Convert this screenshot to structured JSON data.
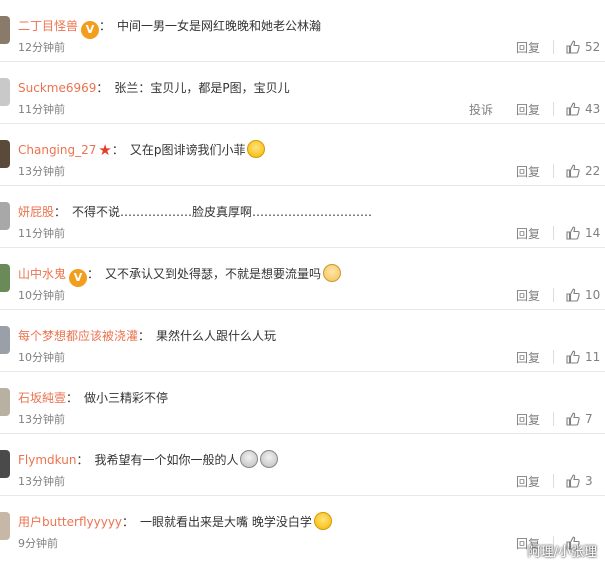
{
  "colors": {
    "username": "#eb7350",
    "text": "#333333",
    "meta": "#808080",
    "divider": "#e8e8e8"
  },
  "labels": {
    "reply": "回复",
    "report": "投诉"
  },
  "comments": [
    {
      "user": "二丁目怪兽",
      "badge": "v-badge",
      "text": "中间一男一女是网红晚晚和她老公林瀚",
      "time": "12分钟前",
      "likes": "52",
      "report": false,
      "emoji": ""
    },
    {
      "user": "Suckme6969",
      "badge": "",
      "text": "张兰：宝贝儿，都是P图，宝贝儿",
      "time": "11分钟前",
      "likes": "43",
      "report": true,
      "emoji": ""
    },
    {
      "user": "Changing_27",
      "badge": "star-badge",
      "text": "又在p图诽谤我们小菲",
      "time": "13分钟前",
      "likes": "22",
      "report": false,
      "emoji": "smile"
    },
    {
      "user": "妍屁股",
      "badge": "",
      "text": "不得不说………………脸皮真厚啊…………………………",
      "time": "11分钟前",
      "likes": "14",
      "report": false,
      "emoji": ""
    },
    {
      "user": "山中水鬼",
      "badge": "v-badge",
      "text": "又不承认又到处得瑟，不就是想要流量吗",
      "time": "10分钟前",
      "likes": "10",
      "report": false,
      "emoji": "cat"
    },
    {
      "user": "每个梦想都应该被浇灌",
      "badge": "",
      "text": "果然什么人跟什么人玩",
      "time": "10分钟前",
      "likes": "11",
      "report": false,
      "emoji": ""
    },
    {
      "user": "石坂純壹",
      "badge": "",
      "text": "做小三精彩不停",
      "time": "13分钟前",
      "likes": "7",
      "report": false,
      "emoji": ""
    },
    {
      "user": "Flymdkun",
      "badge": "",
      "text": "我希望有一个如你一般的人",
      "time": "13分钟前",
      "likes": "3",
      "report": false,
      "emoji": "shock2"
    },
    {
      "user": "用户butterflyyyyy",
      "badge": "",
      "text": "一眼就看出来是大嘴 晚学没白学",
      "time": "9分钟前",
      "likes": "",
      "report": false,
      "emoji": "cry"
    }
  ],
  "watermark": "阿理/小张理"
}
